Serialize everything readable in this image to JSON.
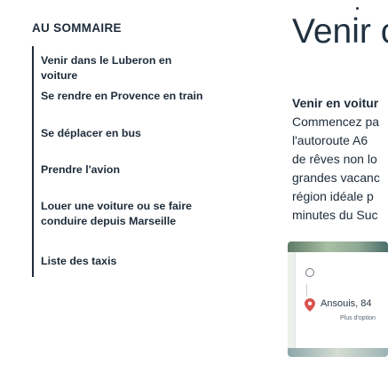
{
  "toc": {
    "title": "AU SOMMAIRE",
    "items": [
      {
        "lines": [
          "Venir dans le Luberon en voiture"
        ]
      },
      {
        "lines": [
          "Se rendre en Provence en train"
        ]
      },
      {
        "lines": [
          "Se déplacer en bus"
        ]
      },
      {
        "lines": [
          "Prendre l'avion"
        ]
      },
      {
        "lines": [
          "Louer une voiture ou se faire",
          "conduire depuis Marseille"
        ]
      },
      {
        "lines": [
          "Liste des taxis"
        ]
      }
    ]
  },
  "article": {
    "title": "Venir c",
    "paragraph_lines": [
      {
        "text": "Venir en voitur",
        "bold": true
      },
      {
        "text": "Commencez pa",
        "bold": false
      },
      {
        "text": "l'autoroute A6",
        "bold": false
      },
      {
        "text": "de rêves non lo",
        "bold": false
      },
      {
        "text": "grandes vacanc",
        "bold": false
      },
      {
        "text": "région idéale p",
        "bold": false
      },
      {
        "text": "minutes du Suc",
        "bold": false
      }
    ]
  },
  "map": {
    "place": "Ansouis, 84",
    "more_options": "Plus d'option"
  }
}
